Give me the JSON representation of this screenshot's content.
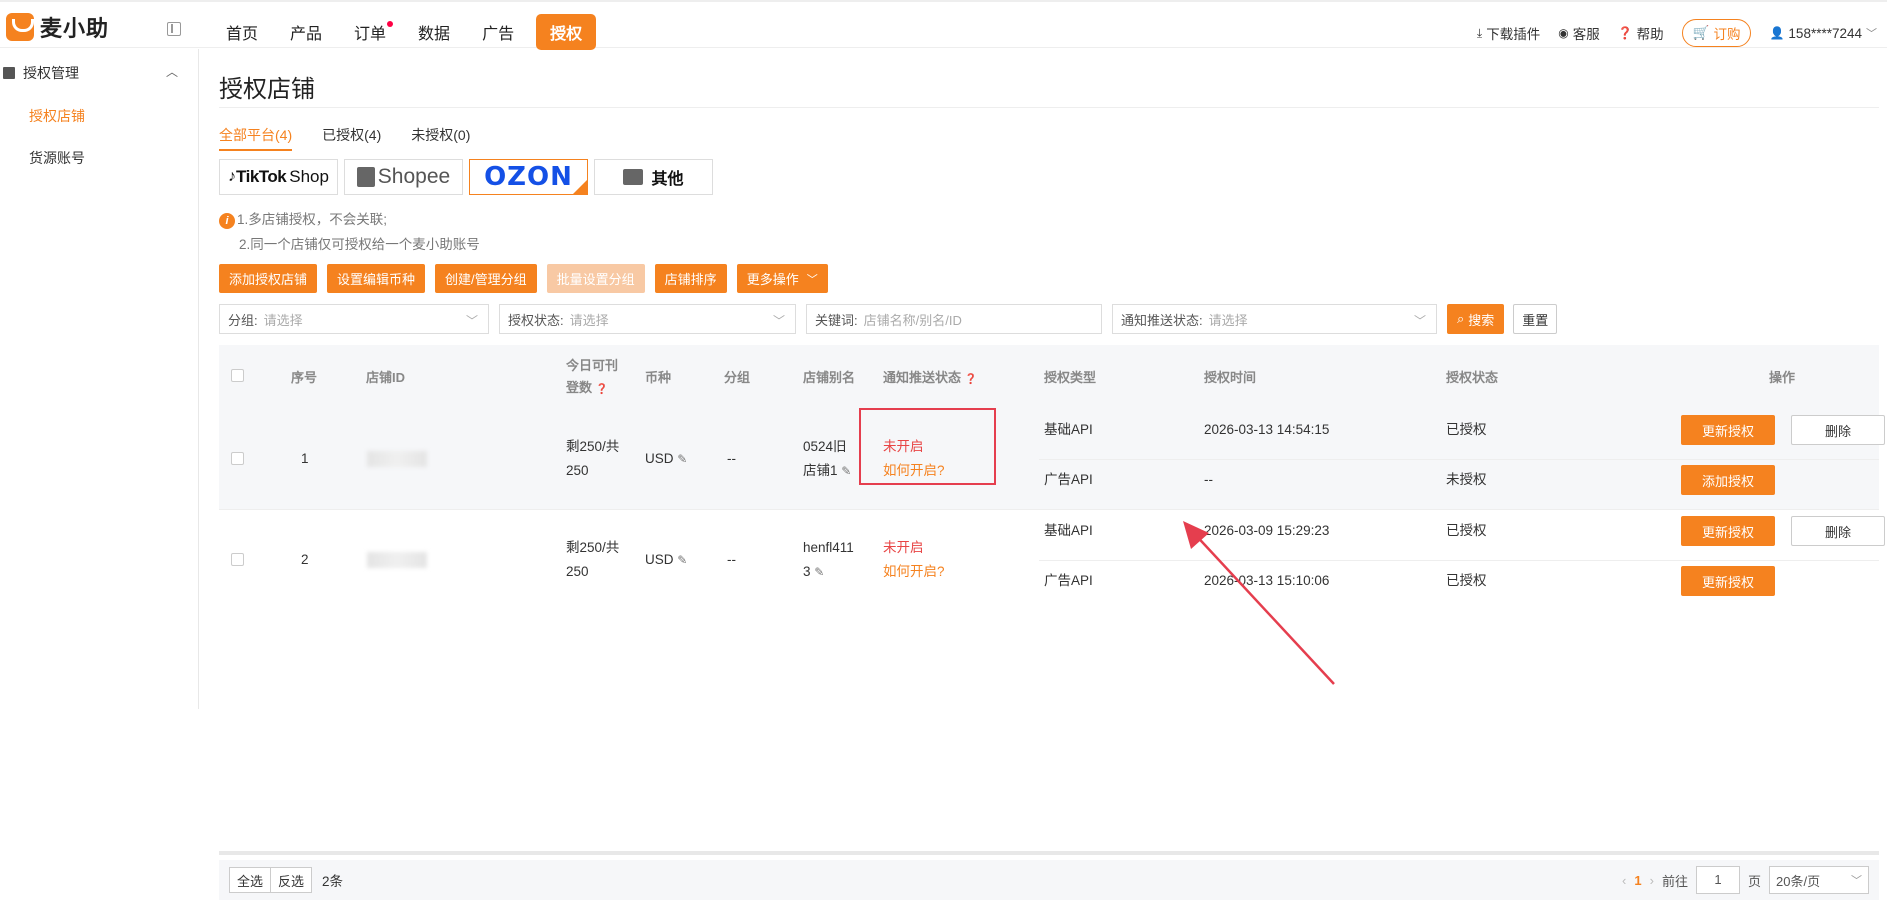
{
  "brand": {
    "name": "麦小助",
    "accent": "#f5821f"
  },
  "nav": {
    "items": [
      "首页",
      "产品",
      "订单",
      "数据",
      "广告"
    ],
    "active": "授权"
  },
  "topright": {
    "download": "下载插件",
    "service": "客服",
    "help": "帮助",
    "order": "订购",
    "user": "158****7244"
  },
  "sidebar": {
    "group": "授权管理",
    "items": [
      "授权店铺",
      "货源账号"
    ]
  },
  "page": {
    "title": "授权店铺"
  },
  "filter_tabs": [
    "全部平台(4)",
    "已授权(4)",
    "未授权(0)"
  ],
  "platforms": {
    "tiktok": "TikTok",
    "tiktok_shop": "Shop",
    "shopee": "Shopee",
    "ozon": "OZON",
    "other": "其他"
  },
  "tips": [
    "1.多店铺授权，不会关联;",
    "2.同一个店铺仅可授权给一个麦小助账号"
  ],
  "buttons": [
    "添加授权店铺",
    "设置编辑币种",
    "创建/管理分组",
    "批量设置分组",
    "店铺排序",
    "更多操作"
  ],
  "filters": {
    "group": {
      "label": "分组:",
      "placeholder": "请选择"
    },
    "auth": {
      "label": "授权状态:",
      "placeholder": "请选择"
    },
    "keyword": {
      "label": "关键词:",
      "placeholder": "店铺名称/别名/ID"
    },
    "notify": {
      "label": "通知推送状态:",
      "placeholder": "请选择"
    },
    "search": "搜索",
    "reset": "重置"
  },
  "table": {
    "headers": {
      "no": "序号",
      "shop_id": "店铺ID",
      "profit_1": "今日可刊",
      "profit_2": "登数",
      "currency": "币种",
      "group": "分组",
      "alias": "店铺别名",
      "notify": "通知推送状态",
      "auth_type": "授权类型",
      "auth_time": "授权时间",
      "auth_status": "授权状态",
      "action": "操作"
    },
    "rows": [
      {
        "no": "1",
        "quota_1": "剩250/共",
        "quota_2": "250",
        "currency": "USD",
        "group": "--",
        "alias_1": "0524旧",
        "alias_2": "店铺1",
        "notify_1": "未开启",
        "notify_2": "如何开启?",
        "subs": [
          {
            "type": "基础API",
            "time": "2026-03-13 14:54:15",
            "status": "已授权",
            "btn": "更新授权",
            "del": "删除"
          },
          {
            "type": "广告API",
            "time": "--",
            "status": "未授权",
            "btn": "添加授权"
          }
        ]
      },
      {
        "no": "2",
        "quota_1": "剩250/共",
        "quota_2": "250",
        "currency": "USD",
        "group": "--",
        "alias_1": "henfl411",
        "alias_2": "3",
        "notify_1": "未开启",
        "notify_2": "如何开启?",
        "subs": [
          {
            "type": "基础API",
            "time": "2026-03-09 15:29:23",
            "status": "已授权",
            "btn": "更新授权",
            "del": "删除"
          },
          {
            "type": "广告API",
            "time": "2026-03-13 15:10:06",
            "status": "已授权",
            "btn": "更新授权"
          }
        ]
      }
    ]
  },
  "footer": {
    "select_all": "全选",
    "invert": "反选",
    "count": "2条",
    "page": "1",
    "goto": "前往",
    "page_input": "1",
    "page_unit": "页",
    "page_size": "20条/页"
  }
}
